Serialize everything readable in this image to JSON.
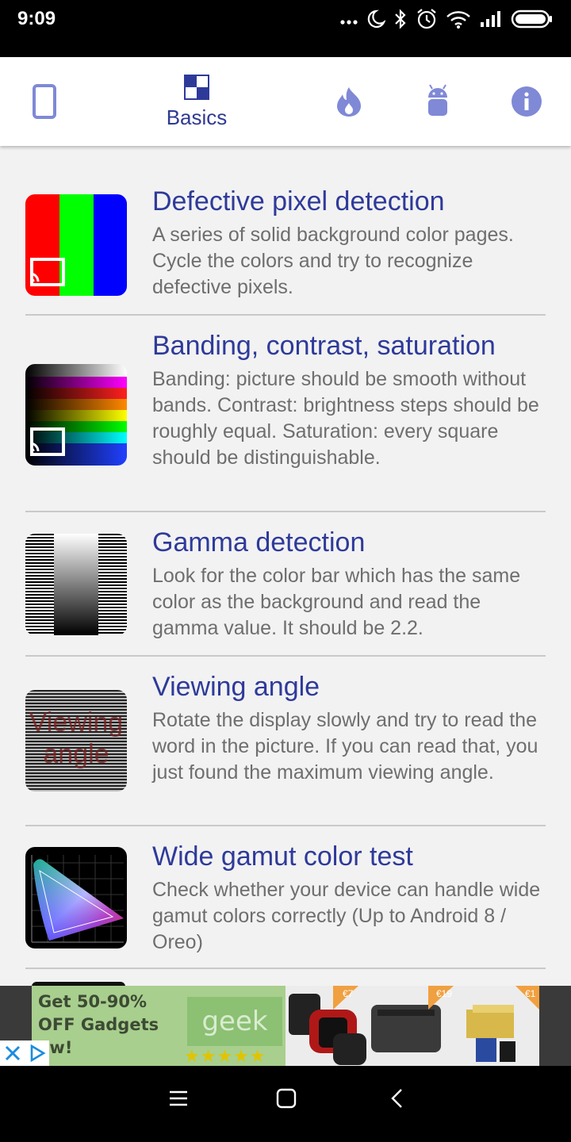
{
  "status_bar": {
    "time": "9:09"
  },
  "tabs": [
    {
      "id": "device",
      "label": "",
      "icon": "phone-icon"
    },
    {
      "id": "basics",
      "label": "Basics",
      "icon": "checker-icon",
      "active": true
    },
    {
      "id": "burn",
      "label": "",
      "icon": "flame-icon"
    },
    {
      "id": "android",
      "label": "",
      "icon": "android-icon"
    },
    {
      "id": "info",
      "label": "",
      "icon": "info-icon"
    }
  ],
  "items": [
    {
      "title": "Defective pixel detection",
      "description": "A series of solid background color pages. Cycle the colors and try to recognize defective pixels."
    },
    {
      "title": "Banding, contrast, saturation",
      "description": "Banding: picture should be smooth without bands. Contrast: brightness steps should be roughly equal. Saturation: every square should be distinguishable."
    },
    {
      "title": "Gamma detection",
      "description": "Look for the color bar which has the same color as the background and read the gamma value. It should be 2.2."
    },
    {
      "title": "Viewing angle",
      "description": "Rotate the display slowly and try to read the word in the picture. If you can read that, you just found the maximum viewing angle.",
      "thumb_text_1": "Viewing",
      "thumb_text_2": "angle"
    },
    {
      "title": "Wide gamut color test",
      "description": "Check whether your device can handle wide gamut colors correctly (Up to Android 8 / Oreo)"
    }
  ],
  "ad": {
    "text": "Get 50-90%\nOFF Gadgets\now!",
    "logo": "geek",
    "stars": "★★★★★",
    "price_tags": [
      "€7",
      "€19",
      "€1"
    ]
  },
  "colors": {
    "accent": "#2e3a9a",
    "icon": "#7f89d6",
    "background": "#f2f2f2",
    "divider": "#c9c9c9"
  }
}
